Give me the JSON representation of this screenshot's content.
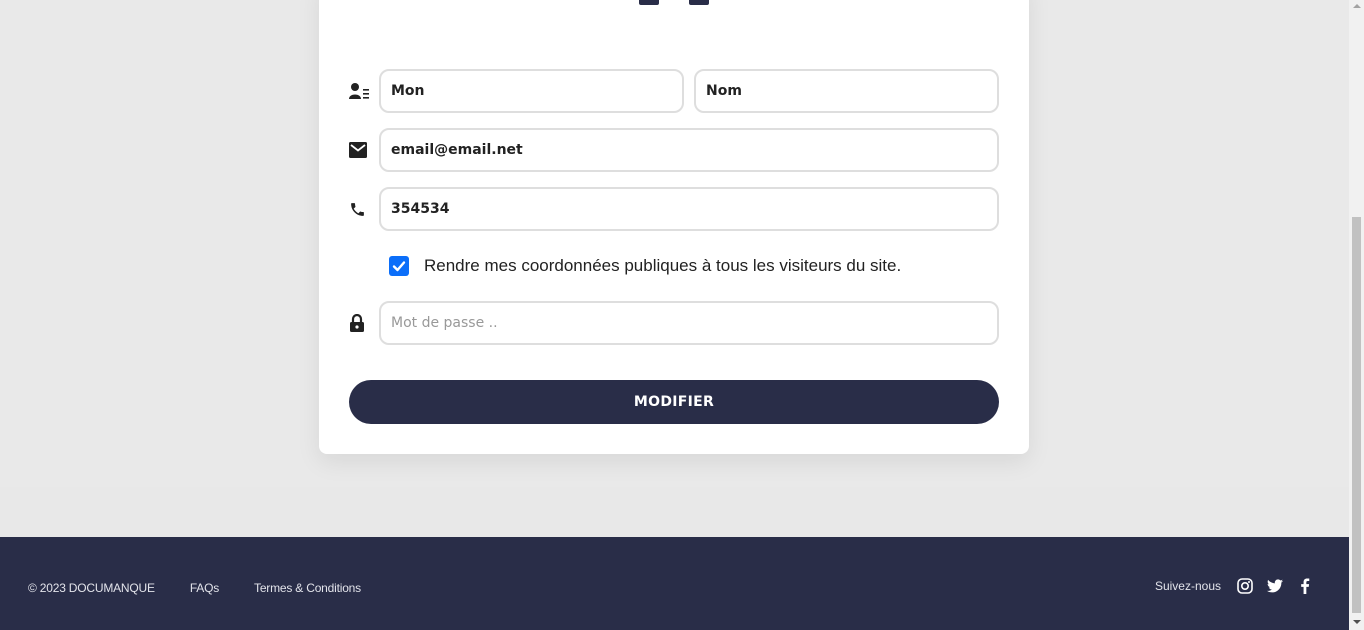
{
  "form": {
    "first_name": {
      "value": "Mon"
    },
    "last_name": {
      "value": "Nom"
    },
    "email": {
      "value": "email@email.net"
    },
    "phone": {
      "value": "354534"
    },
    "public_contact": {
      "checked": true,
      "label": "Rendre mes coordonnées publiques à tous les visiteurs du site."
    },
    "password": {
      "placeholder": "Mot de passe .."
    },
    "submit_label": "MODIFIER"
  },
  "footer": {
    "copyright": "© 2023 DOCUMANQUE",
    "links": [
      "FAQs",
      "Termes & Conditions"
    ],
    "follow_label": "Suivez-nous",
    "social": [
      "instagram-icon",
      "twitter-icon",
      "facebook-icon"
    ]
  },
  "colors": {
    "brand_dark": "#292d48",
    "checkbox_blue": "#0b6ef9",
    "page_bg": "#e8e8e8"
  }
}
